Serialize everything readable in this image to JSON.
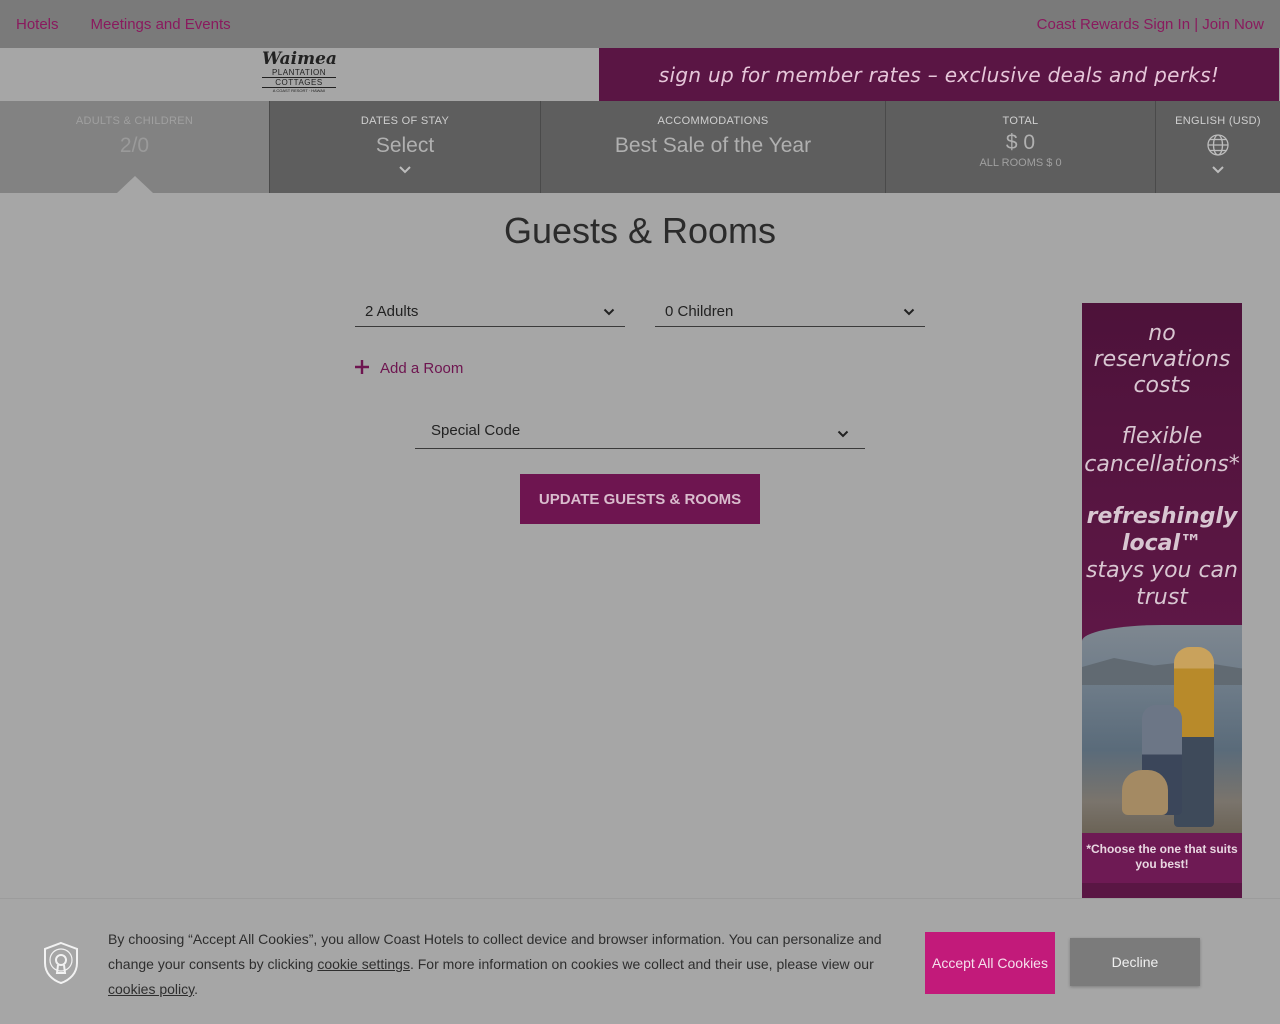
{
  "topnav": {
    "hotels": "Hotels",
    "meetings": "Meetings and Events",
    "rewards": "Coast Rewards Sign In | Join Now"
  },
  "brand": {
    "logo": {
      "line1": "Waimea",
      "line2": "PLANTATION",
      "line3": "COTTAGES",
      "line4": "A COAST RESORT · HAWAII"
    },
    "banner_text": "sign up for member rates – exclusive deals and perks!"
  },
  "booking_bar": {
    "guests": {
      "label": "ADULTS & CHILDREN",
      "value": "2/0"
    },
    "dates": {
      "label": "DATES OF STAY",
      "value": "Select"
    },
    "accommodations": {
      "label": "ACCOMMODATIONS",
      "value": "Best Sale of the Year"
    },
    "total": {
      "label": "TOTAL",
      "value": "$ 0",
      "sub": "ALL ROOMS $ 0"
    },
    "language": {
      "label": "ENGLISH (USD)"
    }
  },
  "main": {
    "title": "Guests & Rooms",
    "adults": "2 Adults",
    "children": "0 Children",
    "add_room": "Add a Room",
    "special_code": "Special Code",
    "update_button": "UPDATE GUESTS & ROOMS"
  },
  "ad": {
    "line1": "no reservations costs",
    "line2": "flexible cancellations*",
    "line3": "refreshingly local™",
    "line4": "stays you can trust",
    "footnote": "*Choose the one that suits you best!"
  },
  "cookie": {
    "text_before": "By choosing “Accept All Cookies”, you allow Coast Hotels to collect device and browser information. You can personalize and change your consents by clicking ",
    "settings_link": "cookie settings",
    "text_middle": ". For more information on cookies we collect and their use, please view our ",
    "policy_link": "cookies policy",
    "text_after": ".",
    "accept": "Accept All Cookies",
    "decline": "Decline"
  },
  "colors": {
    "brand": "#6e1550",
    "accept": "#c21a7a",
    "link": "#8a1a5e"
  }
}
